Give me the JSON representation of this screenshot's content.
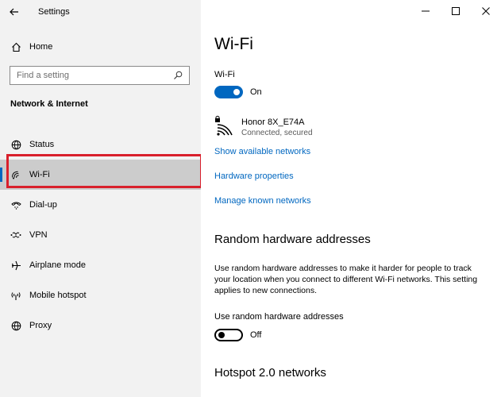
{
  "window": {
    "title": "Settings"
  },
  "sidebar": {
    "home_label": "Home",
    "search_placeholder": "Find a setting",
    "section_title": "Network & Internet",
    "items": [
      {
        "label": "Status",
        "icon": "globe-status-icon"
      },
      {
        "label": "Wi-Fi",
        "icon": "wifi-icon",
        "selected": true
      },
      {
        "label": "Dial-up",
        "icon": "dialup-icon"
      },
      {
        "label": "VPN",
        "icon": "vpn-icon"
      },
      {
        "label": "Airplane mode",
        "icon": "airplane-icon"
      },
      {
        "label": "Mobile hotspot",
        "icon": "hotspot-icon"
      },
      {
        "label": "Proxy",
        "icon": "globe-icon"
      }
    ]
  },
  "main": {
    "title": "Wi-Fi",
    "wifi_label": "Wi-Fi",
    "wifi_toggle_state": "On",
    "network": {
      "name": "Honor 8X_E74A",
      "status": "Connected, secured"
    },
    "links": {
      "show_networks": "Show available networks",
      "hardware_properties": "Hardware properties",
      "manage_networks": "Manage known networks"
    },
    "random_hw": {
      "heading": "Random hardware addresses",
      "description": "Use random hardware addresses to make it harder for people to track your location when you connect to different Wi-Fi networks. This setting applies to new connections.",
      "toggle_label": "Use random hardware addresses",
      "toggle_state": "Off"
    },
    "hotspot": {
      "heading": "Hotspot 2.0 networks"
    }
  },
  "colors": {
    "accent": "#0067c0",
    "highlight": "#d9202c",
    "sidebar_bg": "#f2f2f2",
    "selected_bg": "#cccccc"
  }
}
